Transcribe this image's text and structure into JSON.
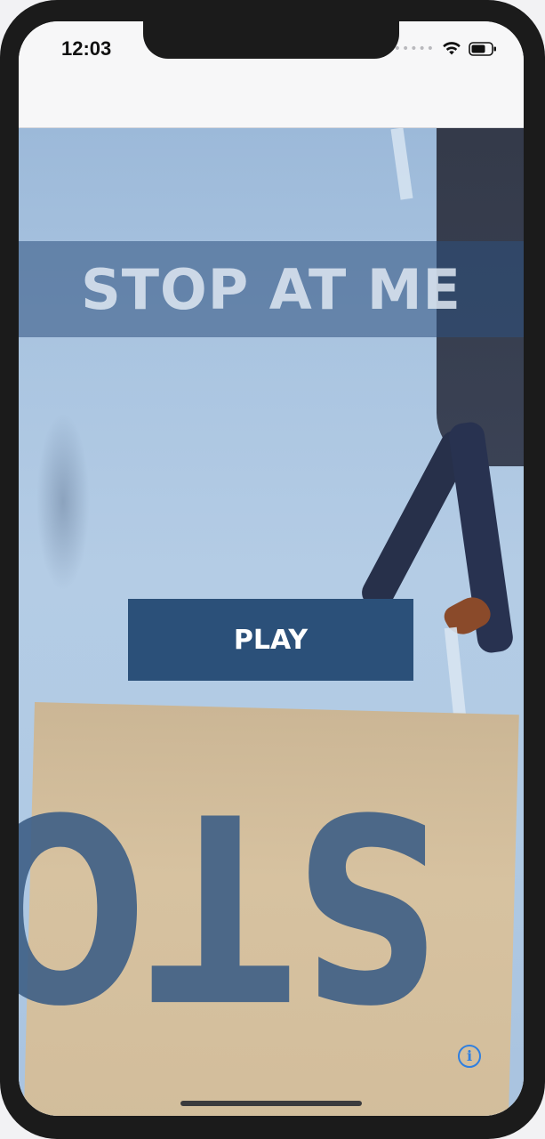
{
  "status_bar": {
    "time": "12:03",
    "signal": "•••••",
    "wifi_icon": "wifi-icon",
    "battery_icon": "battery-icon"
  },
  "main": {
    "title": "STOP AT ME",
    "play_label": "PLAY",
    "info_icon": "info-icon",
    "info_glyph": "i",
    "background_mat_text": "STOP"
  },
  "colors": {
    "banner": "#2e507d",
    "play_button": "#2b5079",
    "info_accent": "#2f7fe0"
  }
}
